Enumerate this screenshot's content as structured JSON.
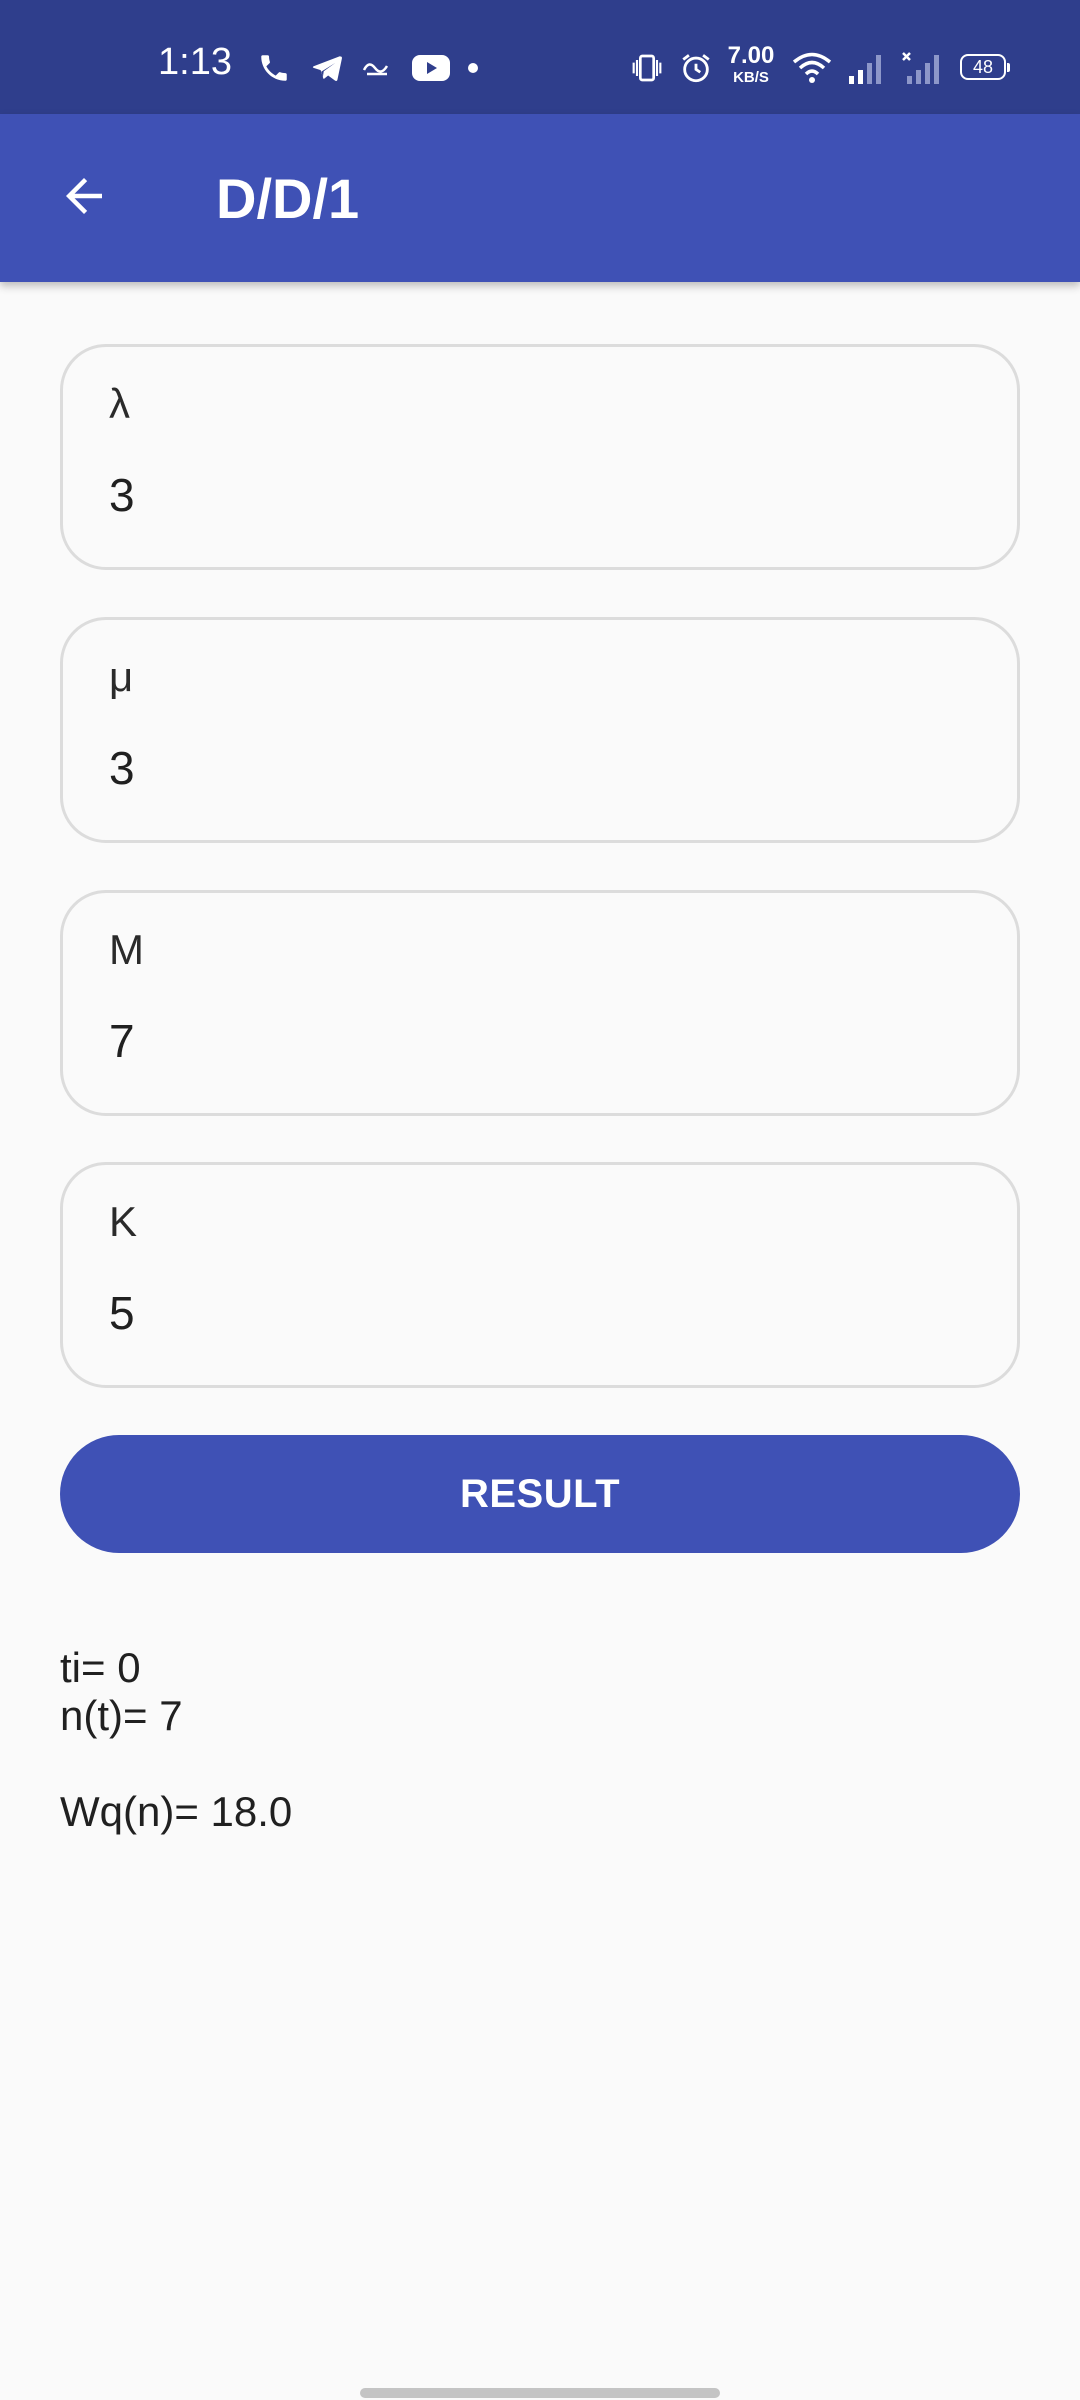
{
  "status_bar": {
    "time": "1:13",
    "net_speed_value": "7.00",
    "net_speed_unit": "KB/S",
    "battery_level": "48",
    "icons": [
      "phone-icon",
      "telegram-icon",
      "app-icon",
      "youtube-icon",
      "dot-icon",
      "vibrate-icon",
      "alarm-icon",
      "wifi-icon",
      "signal-icon",
      "signal-no-service-icon"
    ]
  },
  "app_bar": {
    "title": "D/D/1",
    "back_icon": "arrow-back-icon"
  },
  "fields": [
    {
      "label": "λ",
      "value": "3"
    },
    {
      "label": "μ",
      "value": "3"
    },
    {
      "label": "M",
      "value": "7"
    },
    {
      "label": "K",
      "value": "5"
    }
  ],
  "result_button": {
    "label": "RESULT"
  },
  "results": {
    "ti": "ti= 0",
    "nt": "n(t)= 7",
    "wq": "Wq(n)= 18.0"
  },
  "colors": {
    "primary": "#3f51b5",
    "status_bar": "#2f3e8c",
    "background": "#fafafa"
  }
}
